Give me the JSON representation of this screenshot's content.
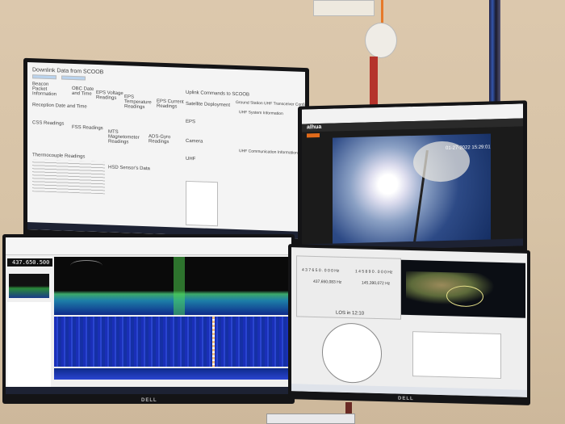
{
  "monitor_tl": {
    "title": "Downlink Data from SCOOB",
    "sections": [
      "Beacon Packet Information",
      "OBC Date and Time",
      "EPS Voltage Readings",
      "EPS Temperature Readings",
      "EPS Current Readings",
      "Reception Date and Time",
      "CSS Readings",
      "FSS Readings",
      "MTS Magnetometer Readings",
      "ADS-Gyro Readings",
      "Thermocouple Readings",
      "HSD Sensor's Data"
    ],
    "uplink_title": "Uplink Commands to SCOOB",
    "uplink_sections": [
      "Satellite Deployment",
      "EPS",
      "Camera",
      "UHF"
    ],
    "gs_title": "Ground Station UHF Transceiver Configuration",
    "gs_sections": [
      "UHF System Information",
      "UHF Communication Information"
    ]
  },
  "monitor_tr": {
    "logo": "alhua",
    "timestamp": "01-27-2022 15:29:01"
  },
  "monitor_bl": {
    "frequency": "437.650.500"
  },
  "monitor_br": {
    "downlink_freq": "4 3 7 6 5 0 . 0 0 0 Hz",
    "uplink_freq": "1 4 5 8 9 0 . 0 0 0 Hz",
    "radio_dl": "437,650,083 Hz",
    "radio_ul": "145,390,072 Hz",
    "los": "LOS in 12:10"
  },
  "brand": "DELL"
}
